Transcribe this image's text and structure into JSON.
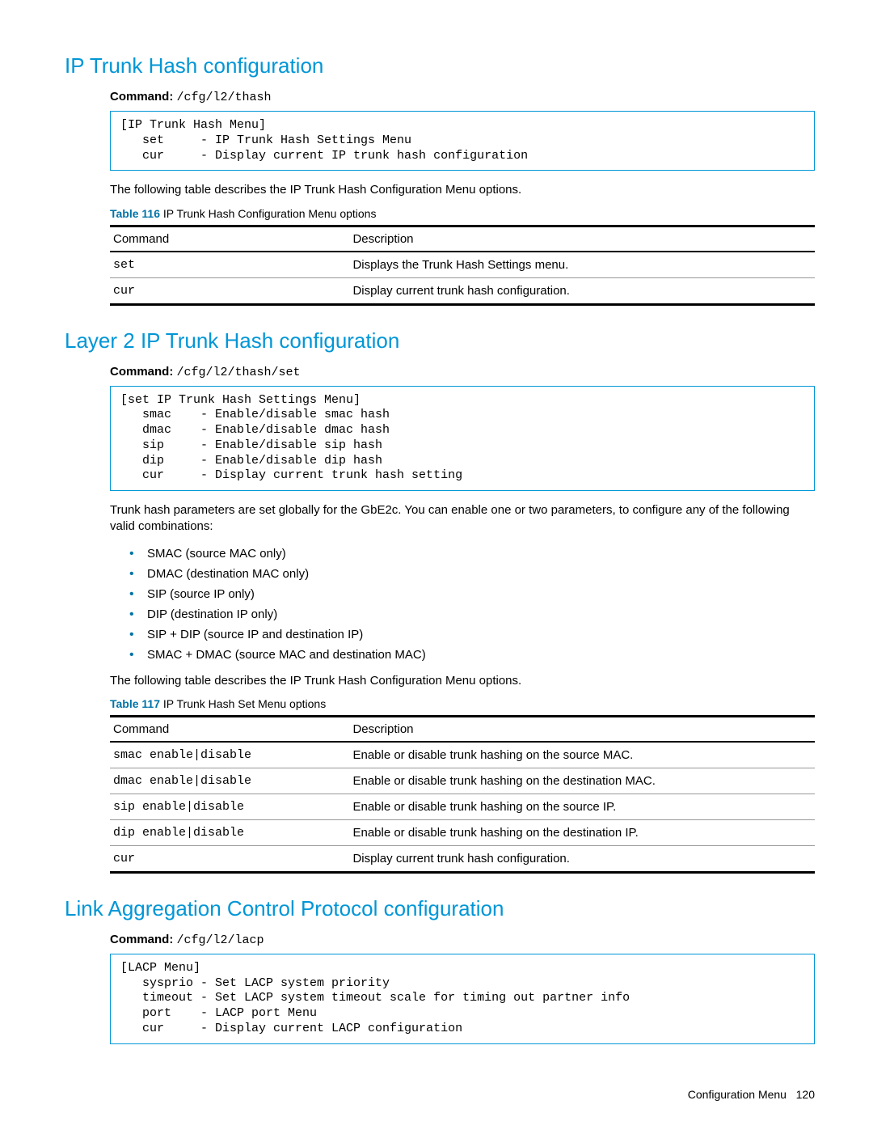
{
  "section1": {
    "heading": "IP Trunk Hash configuration",
    "cmd_label": "Command:",
    "cmd_path": "/cfg/l2/thash",
    "menu": "[IP Trunk Hash Menu]\n   set     - IP Trunk Hash Settings Menu\n   cur     - Display current IP trunk hash configuration",
    "body": "The following table describes the IP Trunk Hash Configuration Menu options.",
    "table_num": "Table 116",
    "table_title": "IP Trunk Hash Configuration Menu options",
    "th_cmd": "Command",
    "th_desc": "Description",
    "rows": [
      {
        "c": "set",
        "d": "Displays the Trunk Hash Settings menu."
      },
      {
        "c": "cur",
        "d": "Display current trunk hash configuration."
      }
    ]
  },
  "section2": {
    "heading": "Layer 2 IP Trunk Hash configuration",
    "cmd_label": "Command:",
    "cmd_path": "/cfg/l2/thash/set",
    "menu": "[set IP Trunk Hash Settings Menu]\n   smac    - Enable/disable smac hash\n   dmac    - Enable/disable dmac hash\n   sip     - Enable/disable sip hash\n   dip     - Enable/disable dip hash\n   cur     - Display current trunk hash setting",
    "body1": "Trunk hash parameters are set globally for the GbE2c. You can enable one or two parameters, to configure any of the following valid combinations:",
    "bullets": [
      "SMAC (source MAC only)",
      "DMAC (destination MAC only)",
      "SIP (source IP only)",
      "DIP (destination IP only)",
      "SIP + DIP (source IP and destination IP)",
      "SMAC + DMAC (source MAC and destination MAC)"
    ],
    "body2": "The following table describes the IP Trunk Hash Configuration Menu options.",
    "table_num": "Table 117",
    "table_title": "IP Trunk Hash Set Menu options",
    "th_cmd": "Command",
    "th_desc": "Description",
    "rows": [
      {
        "c": "smac enable|disable",
        "d": "Enable or disable trunk hashing on the source MAC."
      },
      {
        "c": "dmac enable|disable",
        "d": "Enable or disable trunk hashing on the destination MAC."
      },
      {
        "c": "sip enable|disable",
        "d": "Enable or disable trunk hashing on the source IP."
      },
      {
        "c": "dip enable|disable",
        "d": "Enable or disable trunk hashing on the destination IP."
      },
      {
        "c": "cur",
        "d": "Display current trunk hash configuration."
      }
    ]
  },
  "section3": {
    "heading": "Link Aggregation Control Protocol configuration",
    "cmd_label": "Command:",
    "cmd_path": "/cfg/l2/lacp",
    "menu": "[LACP Menu]\n   sysprio - Set LACP system priority\n   timeout - Set LACP system timeout scale for timing out partner info\n   port    - LACP port Menu\n   cur     - Display current LACP configuration"
  },
  "footer": {
    "label": "Configuration Menu",
    "page": "120"
  }
}
